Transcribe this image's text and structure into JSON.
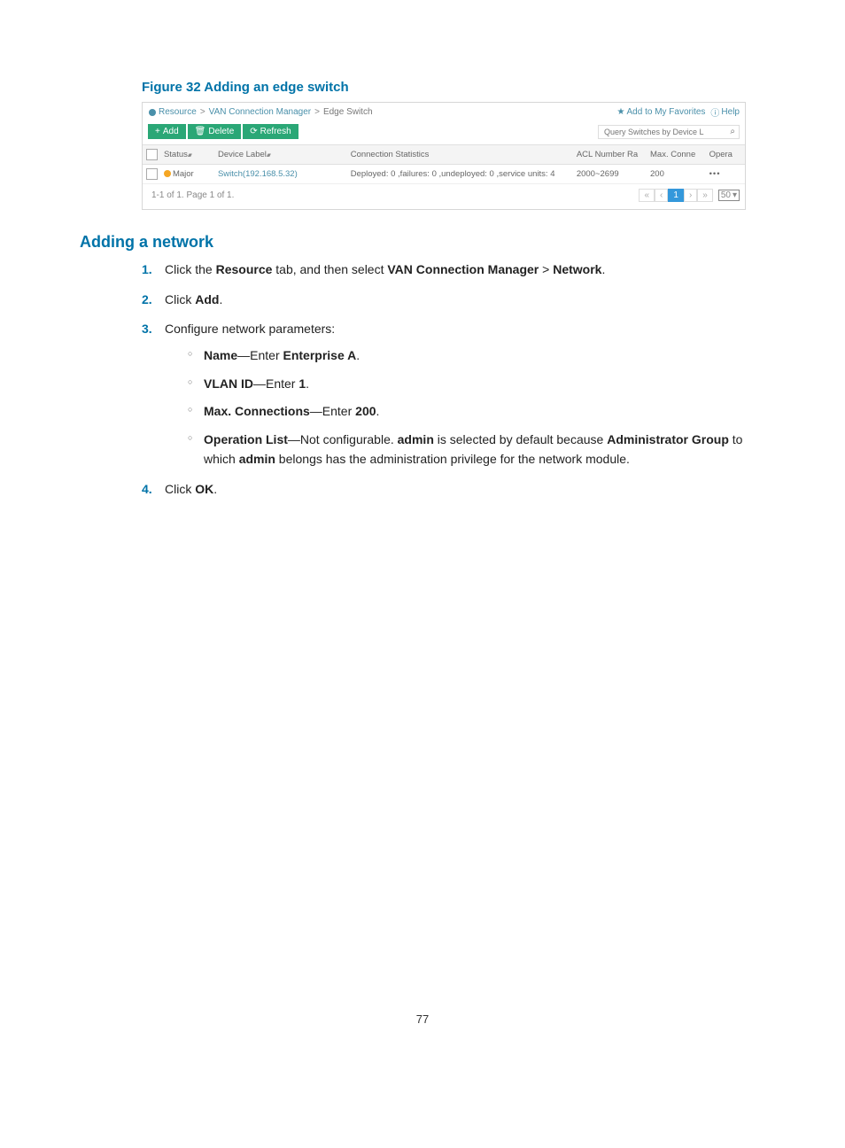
{
  "figure_caption": "Figure 32 Adding an edge switch",
  "screenshot": {
    "breadcrumb": {
      "resource": "Resource",
      "van": "VAN Connection Manager",
      "edge": "Edge Switch"
    },
    "top_right": {
      "favorites": "Add to My Favorites",
      "help": "Help"
    },
    "toolbar": {
      "add": "Add",
      "delete": "Delete",
      "refresh": "Refresh",
      "search_placeholder": "Query Switches by Device L"
    },
    "headers": {
      "status": "Status",
      "device": "Device Label",
      "conn": "Connection Statistics",
      "acl": "ACL Number Ra",
      "max": "Max. Conne",
      "ops": "Opera"
    },
    "row": {
      "status": "Major",
      "device": "Switch(192.168.5.32)",
      "conn": "Deployed: 0 ,failures: 0 ,undeployed: 0 ,service units: 4",
      "acl": "2000~2699",
      "max": "200",
      "ops": "•••"
    },
    "footer": {
      "summary": "1-1 of 1. Page 1 of 1.",
      "first": "«",
      "prev": "‹",
      "page": "1",
      "next": "›",
      "last": "»",
      "perpage": "50"
    }
  },
  "section_heading": "Adding a network",
  "steps": {
    "s1_a": "Click the ",
    "s1_b": "Resource",
    "s1_c": " tab, and then select ",
    "s1_d": "VAN Connection Manager",
    "s1_e": " > ",
    "s1_f": "Network",
    "s1_g": ".",
    "s2_a": "Click ",
    "s2_b": "Add",
    "s2_c": ".",
    "s3": "Configure network parameters:",
    "sub1_a": "Name",
    "sub1_b": "—Enter ",
    "sub1_c": "Enterprise A",
    "sub1_d": ".",
    "sub2_a": "VLAN ID",
    "sub2_b": "—Enter ",
    "sub2_c": "1",
    "sub2_d": ".",
    "sub3_a": "Max. Connections",
    "sub3_b": "—Enter ",
    "sub3_c": "200",
    "sub3_d": ".",
    "sub4_a": "Operation List",
    "sub4_b": "—Not configurable. ",
    "sub4_c": "admin",
    "sub4_d": " is selected by default because ",
    "sub4_e": "Administrator Group",
    "sub4_f": " to which ",
    "sub4_g": "admin",
    "sub4_h": " belongs has the administration privilege for the network module.",
    "s4_a": "Click ",
    "s4_b": "OK",
    "s4_c": "."
  },
  "page_number": "77"
}
